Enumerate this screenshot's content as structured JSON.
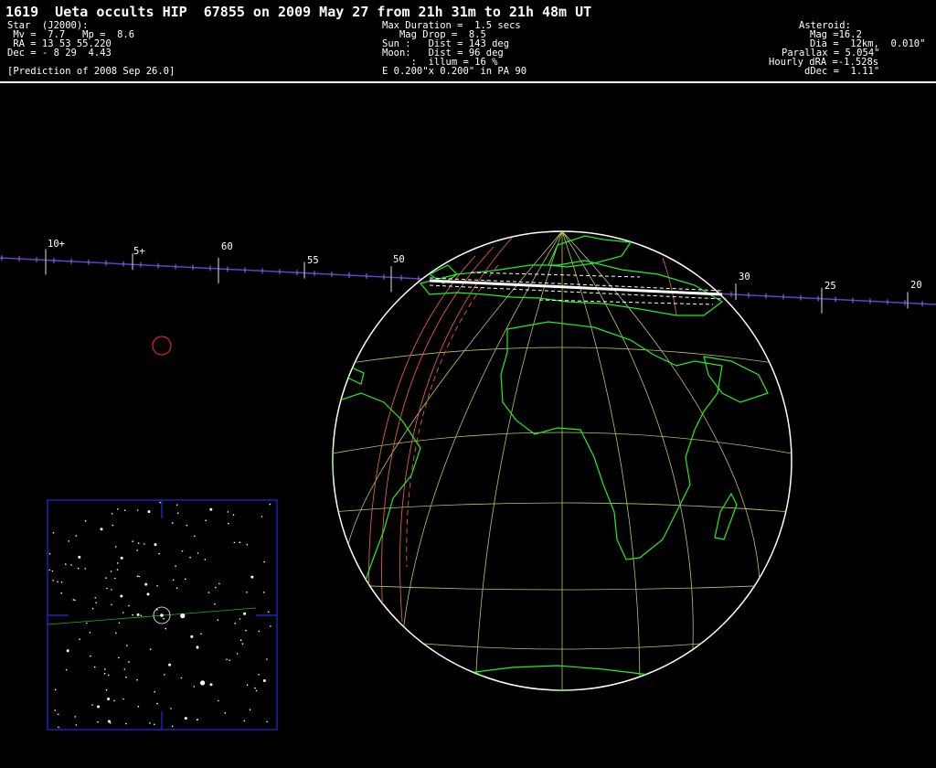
{
  "title": "1619  Ueta occults HIP  67855 on 2009 May 27 from 21h 31m to 21h 48m UT",
  "star": {
    "heading": "Star  (J2000):",
    "mags": " Mv =  7.7   Mp =  8.6",
    "ra": " RA = 13 53 55.220",
    "dec": "Dec = - 8 29  4.43",
    "prediction": "[Prediction of 2008 Sep 26.0]"
  },
  "event": {
    "duration": "Max Duration =  1.5 secs",
    "drop": "   Mag Drop =  8.5",
    "sun": "Sun :   Dist = 143 deg",
    "moon": "Moon:   Dist = 96 deg",
    "illum": "     :  illum = 16 %",
    "ellipse": "E 0.200\"x 0.200\" in PA 90"
  },
  "asteroid": {
    "heading": "Asteroid:",
    "mag": "Mag =16.2",
    "dia": "Dia =  12km,  0.010\"",
    "parallax": "Parallax = 5.054\"",
    "dra": "Hourly dRA =-1.528s",
    "ddec": "dDec =  1.11\""
  },
  "time_axis": {
    "labels": [
      "10+",
      "5+",
      "60",
      "55",
      "50",
      "30",
      "25",
      "20"
    ]
  },
  "colors": {
    "path": "#ffffff",
    "coast": "#22ee22",
    "grid": "#b8c860",
    "track": "#6a3cc8",
    "sun_lines": "#e06040",
    "finder_frame": "#2030e0",
    "marker": "#e02020"
  }
}
